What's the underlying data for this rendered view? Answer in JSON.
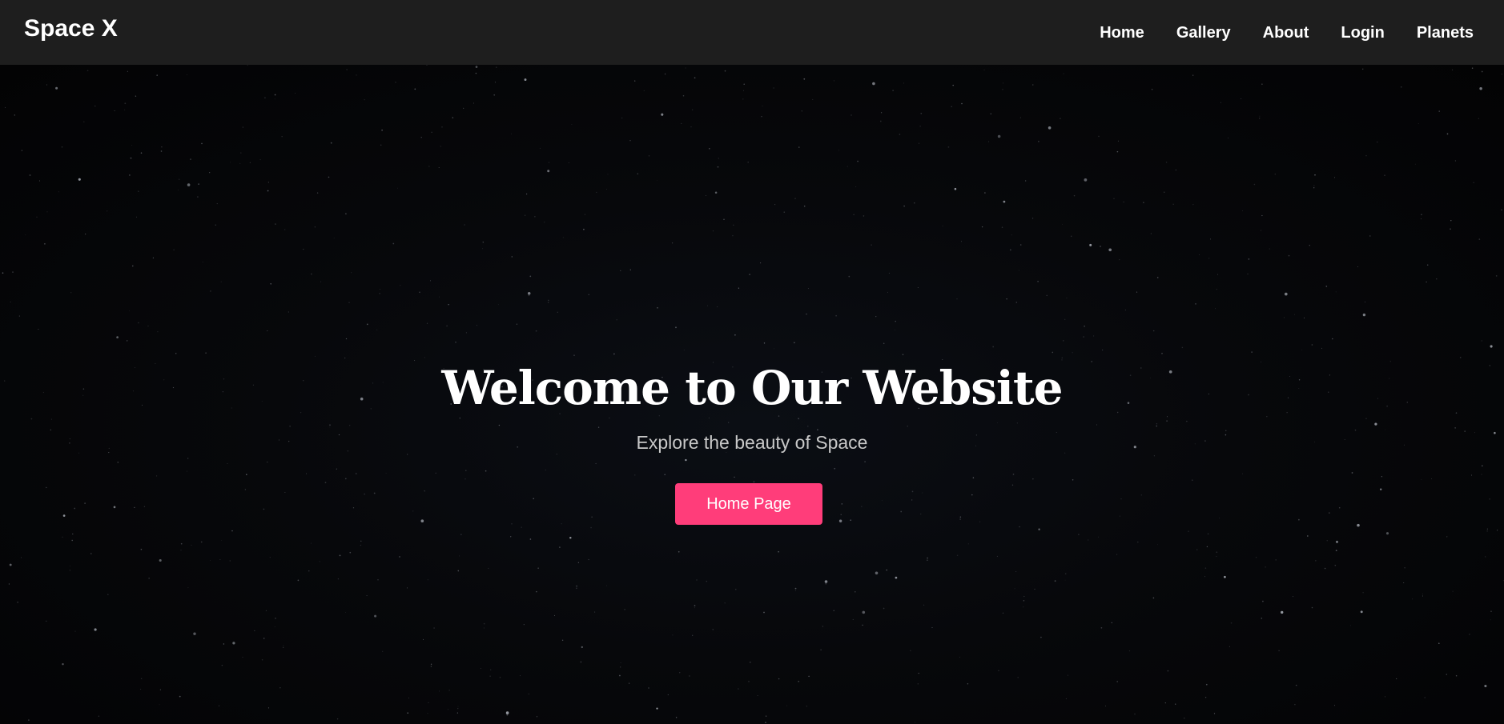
{
  "navbar": {
    "brand": "Space X",
    "links": [
      {
        "label": "Home"
      },
      {
        "label": "Gallery"
      },
      {
        "label": "About"
      },
      {
        "label": "Login"
      },
      {
        "label": "Planets"
      }
    ]
  },
  "hero": {
    "title": "Welcome to Our Website",
    "subtitle": "Explore the beauty of Space",
    "button_label": "Home Page"
  },
  "colors": {
    "navbar_bg": "#1e1e1e",
    "hero_bg": "#050608",
    "accent": "#ff3d7a",
    "subtitle_text": "#c8c8c8"
  }
}
